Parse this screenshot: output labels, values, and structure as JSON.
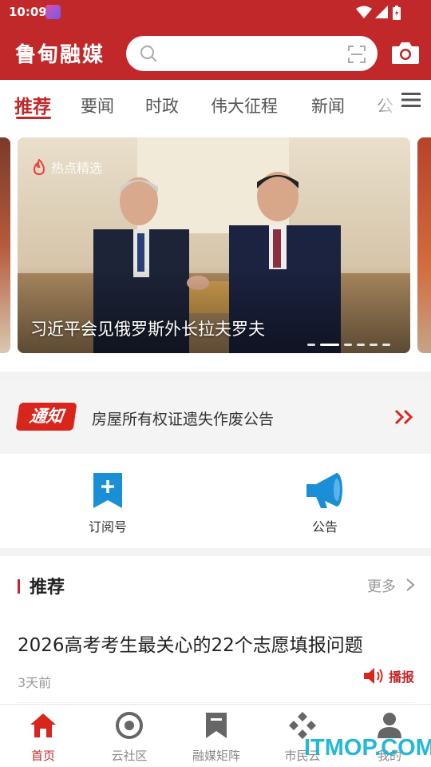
{
  "status_bar": {
    "time": "10:09"
  },
  "header": {
    "title": "鲁甸融媒",
    "search_placeholder": ""
  },
  "tabs": [
    {
      "label": "推荐",
      "active": true
    },
    {
      "label": "要闻",
      "active": false
    },
    {
      "label": "时政",
      "active": false
    },
    {
      "label": "伟大征程",
      "active": false
    },
    {
      "label": "新闻",
      "active": false
    },
    {
      "label": "公",
      "active": false
    }
  ],
  "carousel": {
    "tag": "热点精选",
    "caption": "习近平会见俄罗斯外长拉夫罗夫",
    "slide_count": 7,
    "active_index": 0
  },
  "notice": {
    "badge": "通知",
    "text": "房屋所有权证遗失作废公告"
  },
  "quick_links": [
    {
      "label": "订阅号",
      "icon": "bookmark-plus-icon"
    },
    {
      "label": "公告",
      "icon": "megaphone-icon"
    }
  ],
  "recommend": {
    "title": "推荐",
    "more_label": "更多",
    "article": {
      "title": "2026高考考生最关心的22个志愿填报问题",
      "time": "3天前",
      "broadcast_label": "播报"
    }
  },
  "bottom_nav": [
    {
      "label": "首页",
      "icon": "home-icon",
      "active": true
    },
    {
      "label": "云社区",
      "icon": "community-icon",
      "active": false
    },
    {
      "label": "融媒矩阵",
      "icon": "bookmark-icon",
      "active": false
    },
    {
      "label": "市民云",
      "icon": "diamond-grid-icon",
      "active": false
    },
    {
      "label": "我的",
      "icon": "user-icon",
      "active": false
    }
  ],
  "watermark": "ITMOP.COM",
  "colors": {
    "brand_red": "#c0282a",
    "watermark": "#19b5d4",
    "icon_blue": "#1a8fd6"
  }
}
